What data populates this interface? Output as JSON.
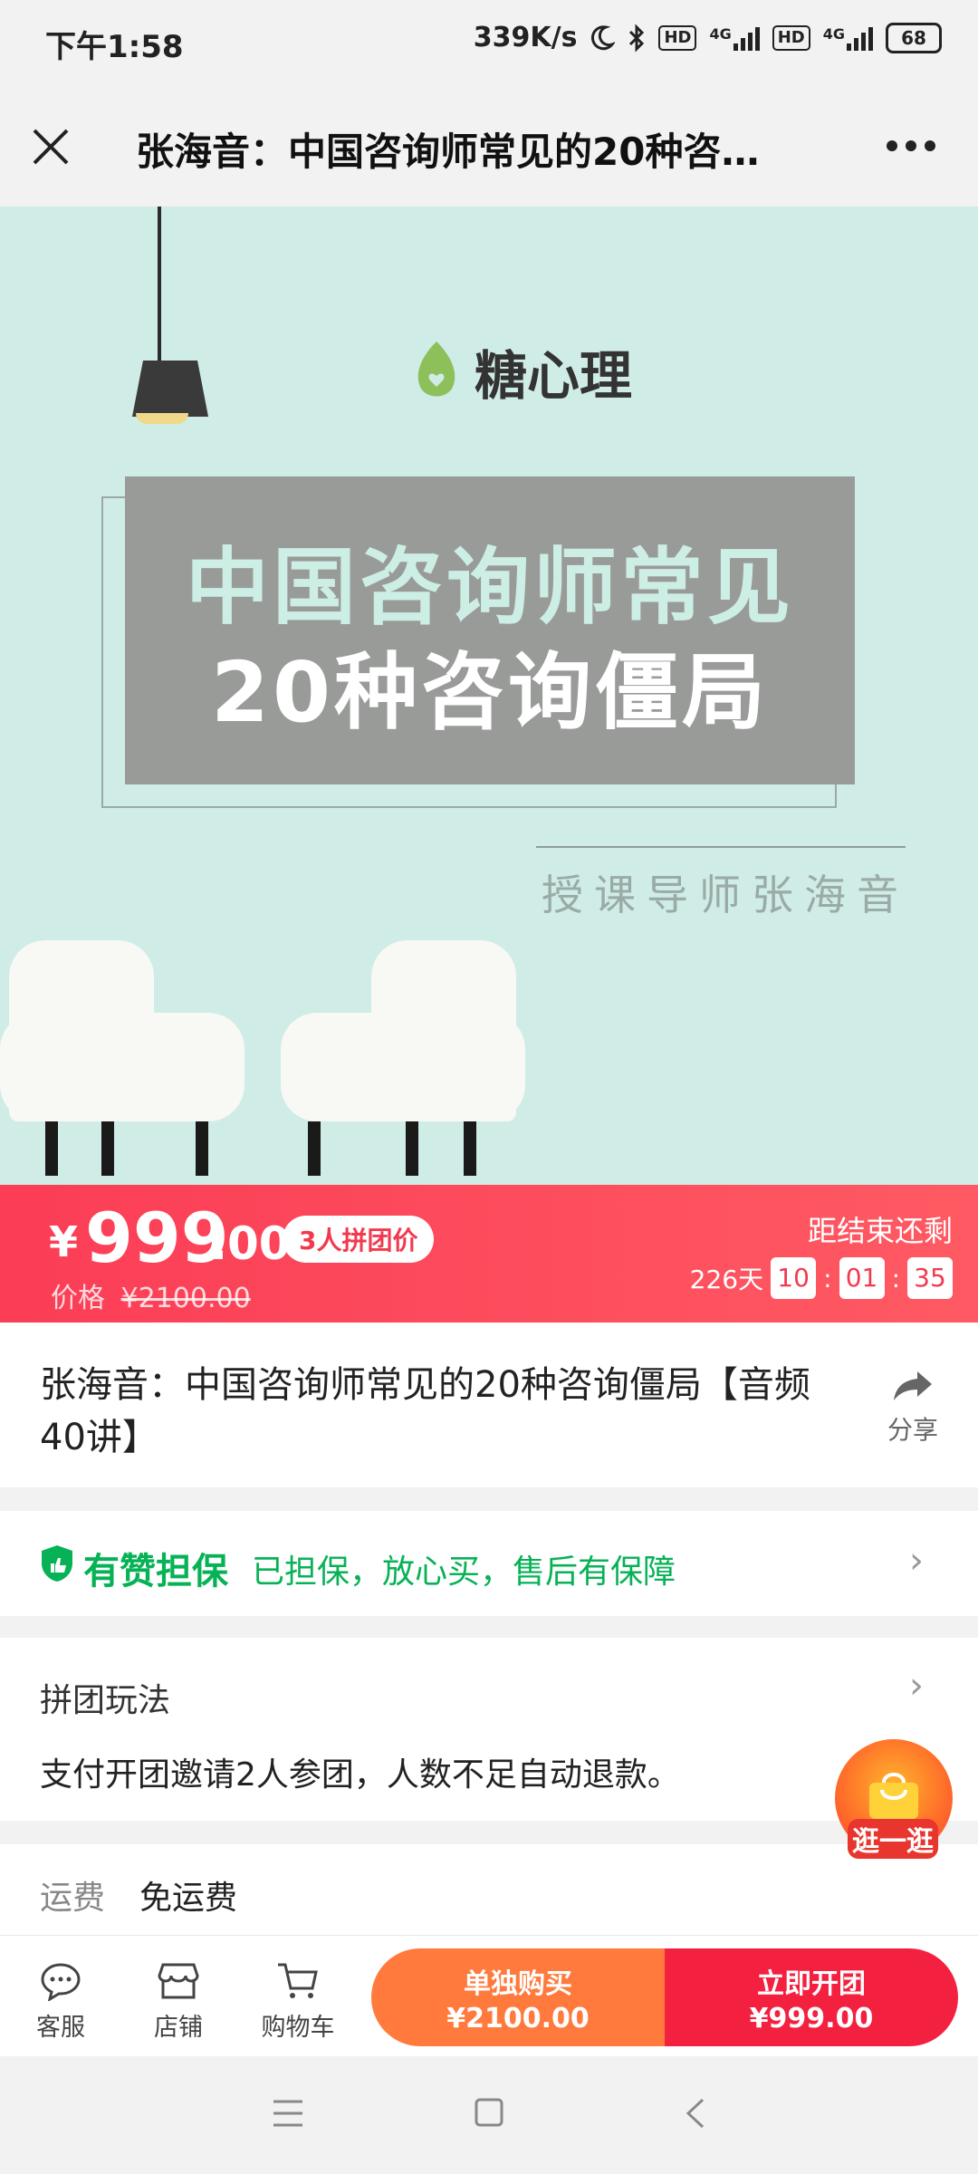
{
  "status_bar": {
    "time": "下午1:58",
    "speed": "339K/s",
    "hd": "HD",
    "net": "4G",
    "battery": "68"
  },
  "title_bar": {
    "title": "张海音：中国咨询师常见的20种咨…"
  },
  "hero": {
    "logo_text": "糖心理",
    "headline_1": "中国咨询师常见",
    "headline_2": "20种咨询僵局",
    "teacher": "授课导师张海音"
  },
  "price": {
    "currency": "¥",
    "integer": "999",
    "decimal": ".00",
    "group_tag": "3人拼团价",
    "original_label": "价格",
    "original_price": "¥2100.00",
    "ends_label": "距结束还剩",
    "days": "226天",
    "hours": "10",
    "minutes": "01",
    "seconds": "35",
    "sep": ":"
  },
  "product": {
    "title": "张海音：中国咨询师常见的20种咨询僵局【音频40讲】",
    "share_label": "分享"
  },
  "guarantee": {
    "brand": "有赞担保",
    "text": "已担保，放心买，售后有保障"
  },
  "group_rules": {
    "label": "拼团玩法",
    "desc": "支付开团邀请2人参团，人数不足自动退款。"
  },
  "shipping": {
    "label": "运费",
    "value": "免运费"
  },
  "floating": {
    "label": "逛一逛"
  },
  "bottom_bar": {
    "service": "客服",
    "store": "店铺",
    "cart": "购物车",
    "single_label": "单独购买",
    "single_price": "¥2100.00",
    "group_label": "立即开团",
    "group_price": "¥999.00"
  },
  "colors": {
    "brand_red": "#f42040",
    "orange": "#ff7a3c",
    "guarantee_green": "#07b256",
    "hero_bg": "#cfece6"
  }
}
